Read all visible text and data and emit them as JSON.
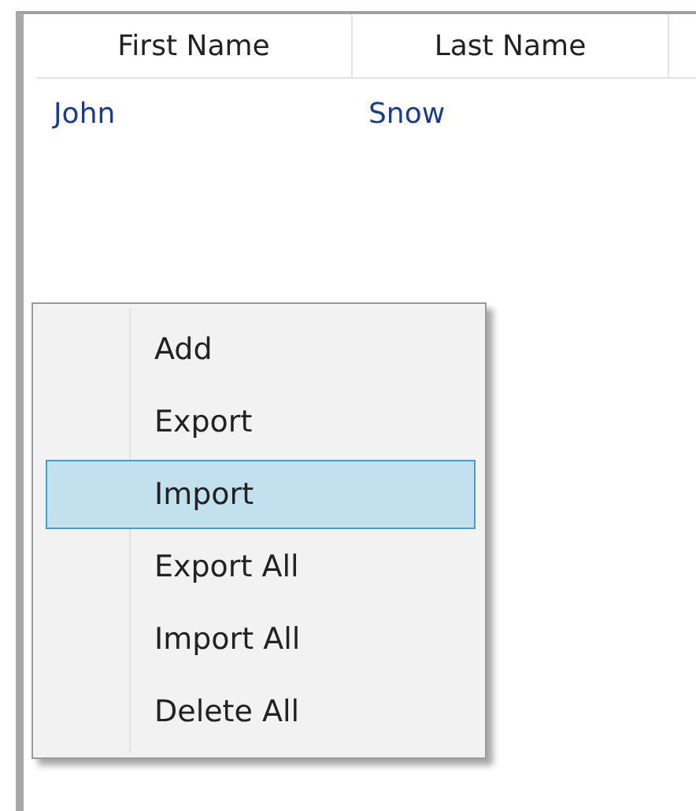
{
  "table": {
    "columns": [
      "First Name",
      "Last Name"
    ],
    "rows": [
      {
        "cells": [
          "John",
          "Snow"
        ],
        "selected": false
      }
    ]
  },
  "context_menu": {
    "items": [
      {
        "label": "Add",
        "selected": false
      },
      {
        "label": "Export",
        "selected": false
      },
      {
        "label": "Import",
        "selected": true
      },
      {
        "label": "Export All",
        "selected": false
      },
      {
        "label": "Import All",
        "selected": false
      },
      {
        "label": "Delete All",
        "selected": false
      }
    ]
  }
}
